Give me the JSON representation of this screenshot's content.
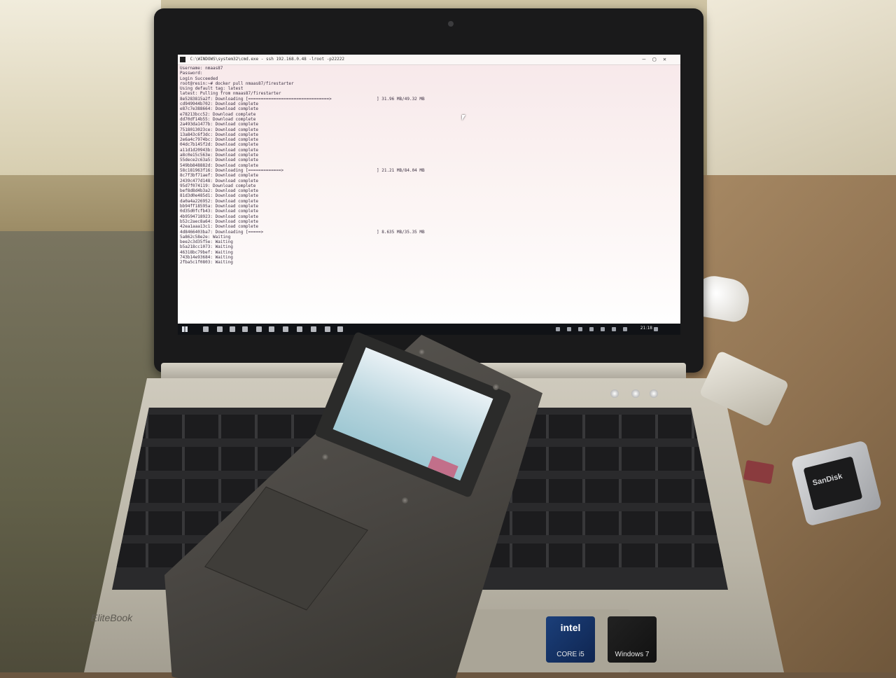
{
  "laptop": {
    "brand": "EliteBook",
    "stickers": {
      "intel_logo": "intel",
      "intel_text": "CORE i5",
      "windows_text": "Windows 7"
    }
  },
  "terminal": {
    "window_title": "C:\\WINDOWS\\system32\\cmd.exe - ssh 192.168.0.48 -lroot -p22222",
    "header_lines": [
      "Username: nmaas87",
      "Password:",
      "Login Succeeded",
      "root@resin:~# docker pull nmaas87/firestarter",
      "Using default tag: latest",
      "latest: Pulling from nmaas87/firestarter"
    ],
    "layers": [
      {
        "id": "8e5283815a2f:",
        "status": "Downloading [================================>"
      },
      {
        "id": "cd949944b702:",
        "status": "Download complete"
      },
      {
        "id": "e87c7e388664:",
        "status": "Download complete"
      },
      {
        "id": "e78213bcc52:",
        "status": "Download complete"
      },
      {
        "id": "dd70df14b55:",
        "status": "Download complete"
      },
      {
        "id": "2a493da1477b:",
        "status": "Download complete"
      },
      {
        "id": "7518013023ce:",
        "status": "Download complete"
      },
      {
        "id": "13a843c6f3dc:",
        "status": "Download complete"
      },
      {
        "id": "2e6a4c7974bc:",
        "status": "Download complete"
      },
      {
        "id": "04dc7b145f2d:",
        "status": "Download complete"
      },
      {
        "id": "a11d1d20943b:",
        "status": "Download complete"
      },
      {
        "id": "a8c0e15c563e:",
        "status": "Download complete"
      },
      {
        "id": "55dece2c63a5:",
        "status": "Download complete"
      },
      {
        "id": "549bb848882d:",
        "status": "Download complete"
      },
      {
        "id": "58c181963f16:",
        "status": "Downloading [=============>"
      },
      {
        "id": "8c7f3bf71aef:",
        "status": "Download complete"
      },
      {
        "id": "2439c477d148:",
        "status": "Download complete"
      },
      {
        "id": "95d7f074119:",
        "status": "Download complete"
      },
      {
        "id": "bef8d8d4b3a2:",
        "status": "Download complete"
      },
      {
        "id": "81d3d0e485d1:",
        "status": "Download complete"
      },
      {
        "id": "da0a4a226952:",
        "status": "Download complete"
      },
      {
        "id": "bb94ff18595a:",
        "status": "Download complete"
      },
      {
        "id": "0d35d0fcfb43:",
        "status": "Download complete"
      },
      {
        "id": "4b9594718923:",
        "status": "Download complete"
      },
      {
        "id": "b52c2aec8a64:",
        "status": "Download complete"
      },
      {
        "id": "42ea1aaa13c1:",
        "status": "Download complete"
      },
      {
        "id": "4d8466403ba7:",
        "status": "Downloading [=====>"
      },
      {
        "id": "5a862c58e2e:",
        "status": "Waiting"
      },
      {
        "id": "bee2c3d35f5e:",
        "status": "Waiting"
      },
      {
        "id": "b5a218cc1073:",
        "status": "Waiting"
      },
      {
        "id": "46318bc79bef:",
        "status": "Waiting"
      },
      {
        "id": "743b14e93684:",
        "status": "Waiting"
      },
      {
        "id": "2fba5c1f0803:",
        "status": "Waiting"
      }
    ],
    "progress": [
      {
        "line": 6,
        "text": "] 31.96 MB/49.32 MB"
      },
      {
        "line": 20,
        "text": "] 21.21 MB/84.04 MB"
      },
      {
        "line": 32,
        "text": "] 8.635 MB/35.35 MB"
      }
    ]
  },
  "taskbar": {
    "time": "21:18"
  },
  "peripherals": {
    "card_reader_brand": "SanDisk"
  },
  "icons": [
    "terminal-icon",
    "windows-start-icon",
    "mouse-cursor-icon"
  ]
}
